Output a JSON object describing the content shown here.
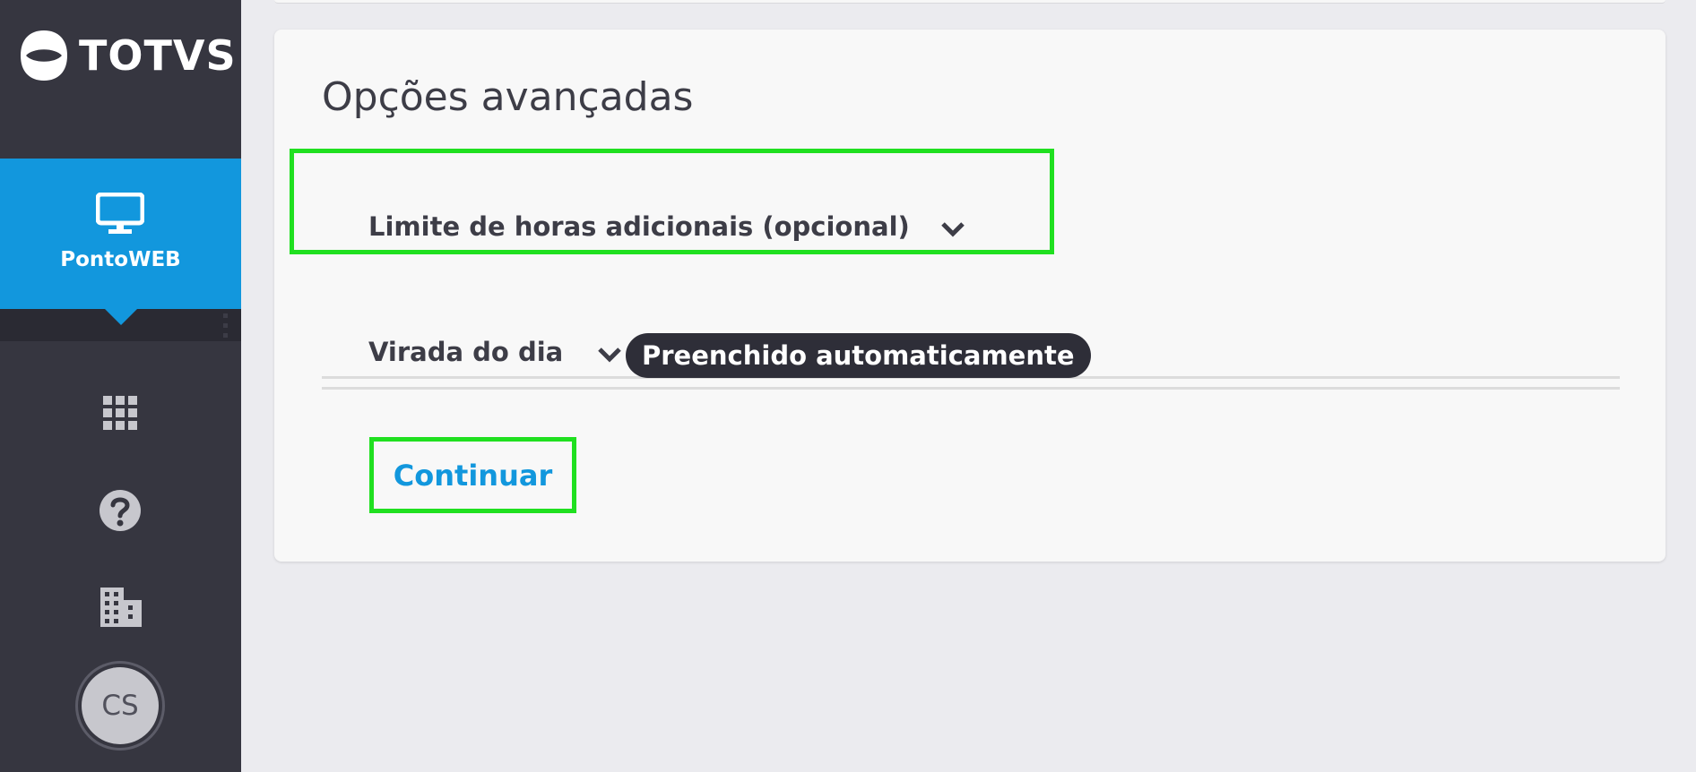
{
  "brand": {
    "name": "TOTVS"
  },
  "sidebar": {
    "app": {
      "label": "PontoWEB",
      "icon": "monitor-icon"
    },
    "items": [
      {
        "icon": "apps-grid-icon"
      },
      {
        "icon": "help-icon"
      },
      {
        "icon": "building-icon"
      }
    ],
    "user": {
      "initials": "CS"
    }
  },
  "main": {
    "title": "Opções avançadas",
    "sections": [
      {
        "label": "Limite de horas adicionais (opcional)",
        "icon": "chevron-down-icon"
      },
      {
        "label": "Virada do dia",
        "icon": "chevron-down-icon",
        "badge": "Preenchido automaticamente"
      }
    ],
    "continue_label": "Continuar"
  },
  "colors": {
    "sidebar": "#363640",
    "accent": "#1297dd",
    "highlight": "#20e020",
    "badge": "#2e2e38"
  }
}
